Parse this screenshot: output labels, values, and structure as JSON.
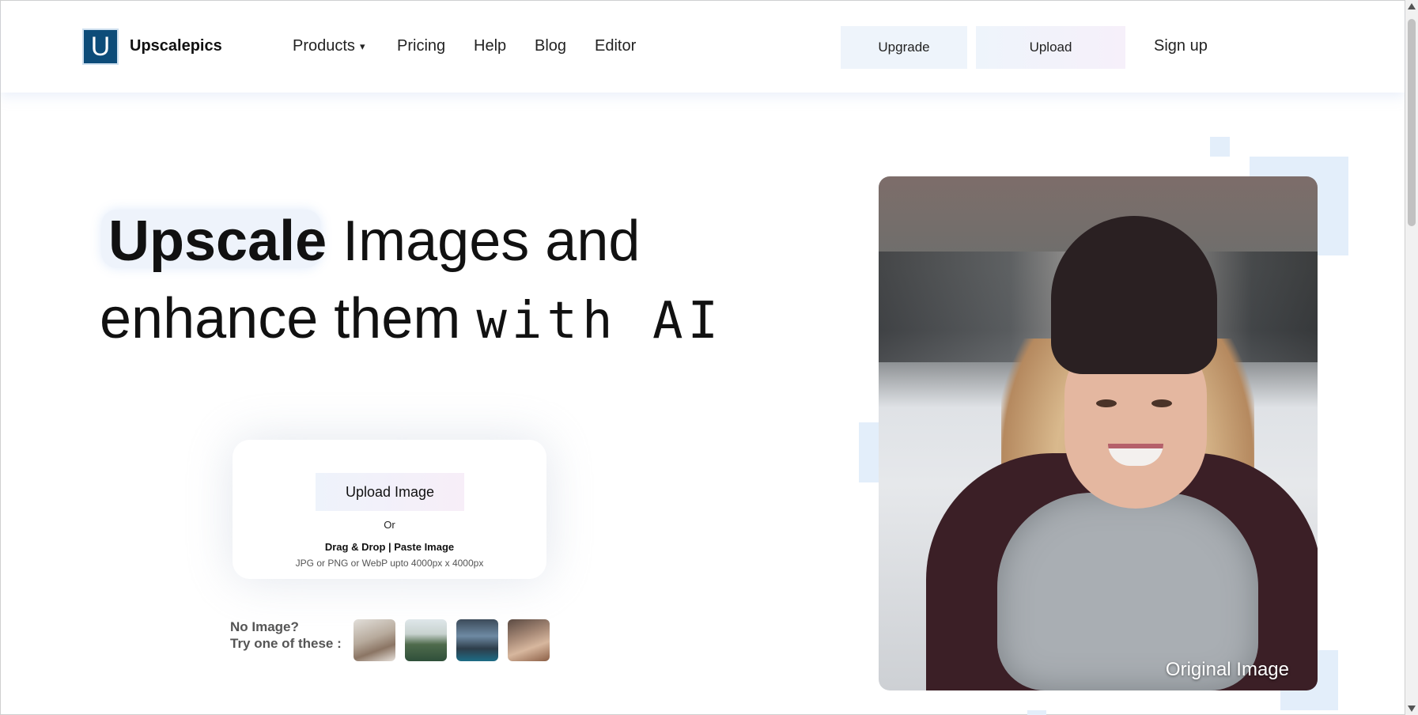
{
  "header": {
    "logo_letter": "U",
    "brand": "Upscalepics",
    "nav": [
      {
        "label": "Products",
        "caret": "▾"
      },
      {
        "label": "Pricing"
      },
      {
        "label": "Help"
      },
      {
        "label": "Blog"
      },
      {
        "label": "Editor"
      }
    ],
    "upgrade_label": "Upgrade",
    "upload_label": "Upload",
    "signup_label": "Sign up"
  },
  "hero": {
    "title_bold": "Upscale",
    "title_rest1": " Images and",
    "title_line2": "enhance them ",
    "title_mono": "with AI"
  },
  "upload_card": {
    "button_label": "Upload Image",
    "or_text": "Or",
    "drag_text": "Drag & Drop | Paste Image",
    "format_text": "JPG or PNG or WebP upto 4000px x 4000px"
  },
  "samples": {
    "line1": "No Image?",
    "line2": "Try one of these :"
  },
  "preview": {
    "label": "Original Image"
  },
  "colors": {
    "logo_bg": "#0d4c79",
    "button_tint": "#eef4fb",
    "deco_square": "#e3eefa"
  }
}
